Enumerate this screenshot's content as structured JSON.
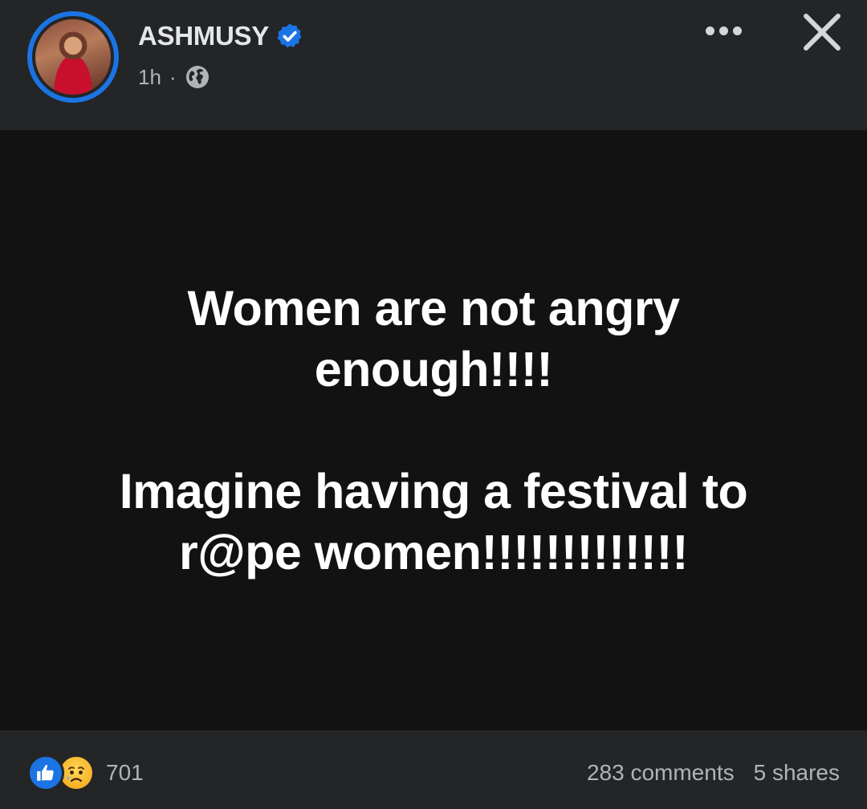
{
  "header": {
    "author_name": "ASHMUSY",
    "verified": true,
    "time": "1h",
    "separator": "·",
    "audience_icon": "globe-icon",
    "more_icon": "more-horizontal-icon",
    "close_icon": "close-icon"
  },
  "post": {
    "lines_block1": [
      "Women are not angry",
      "enough!!!!"
    ],
    "lines_block2": [
      "Imagine having a festival to",
      "r@pe women!!!!!!!!!!!!!"
    ],
    "background_color": "#121212",
    "text_color": "#ffffff"
  },
  "footer": {
    "reaction_icons": [
      "like-reaction-icon",
      "sad-reaction-icon"
    ],
    "reaction_count": "701",
    "comments": "283 comments",
    "shares": "5 shares"
  },
  "colors": {
    "accent": "#1b74e4",
    "surface": "#242526",
    "secondary_text": "#b0b3b8"
  }
}
